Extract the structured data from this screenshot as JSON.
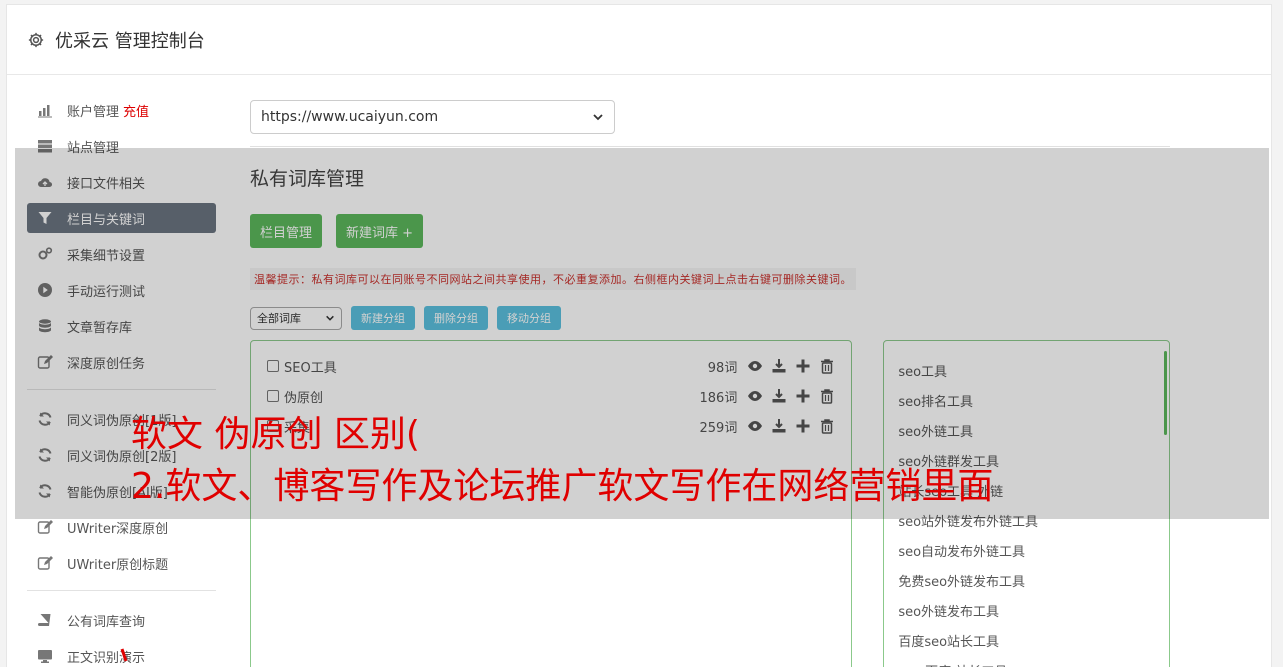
{
  "header": {
    "title": "优采云 管理控制台"
  },
  "sidebar": {
    "group1": [
      {
        "label": "账户管理",
        "badge": "充值",
        "icon": "bar-chart-icon"
      },
      {
        "label": "站点管理",
        "icon": "server-icon"
      },
      {
        "label": "接口文件相关",
        "icon": "cloud-upload-icon"
      },
      {
        "label": "栏目与关键词",
        "icon": "filter-icon",
        "active": true
      },
      {
        "label": "采集细节设置",
        "icon": "gears-icon"
      },
      {
        "label": "手动运行测试",
        "icon": "play-circle-icon"
      },
      {
        "label": "文章暂存库",
        "icon": "database-icon"
      },
      {
        "label": "深度原创任务",
        "icon": "edit-icon"
      }
    ],
    "group2": [
      {
        "label": "同义词伪原创[1版]",
        "icon": "refresh-icon"
      },
      {
        "label": "同义词伪原创[2版]",
        "icon": "refresh-icon"
      },
      {
        "label": "智能伪原创[AI版]",
        "icon": "refresh-icon"
      },
      {
        "label": "UWriter深度原创",
        "icon": "edit-icon"
      },
      {
        "label": "UWriter原创标题",
        "icon": "edit-icon"
      }
    ],
    "group3": [
      {
        "label": "公有词库查询",
        "icon": "book-icon"
      },
      {
        "label": "正文识别演示",
        "icon": "monitor-icon"
      }
    ]
  },
  "main": {
    "site_select": "https://www.ucaiyun.com",
    "section_title": "私有词库管理",
    "buttons": {
      "column_manage": "栏目管理",
      "new_library": "新建词库 +"
    },
    "tip": "温馨提示：私有词库可以在同账号不同网站之间共享使用，不必重复添加。右侧框内关键词上点击右键可删除关键词。",
    "filter_select": "全部词库",
    "group_buttons": {
      "new_group": "新建分组",
      "delete_group": "删除分组",
      "move_group": "移动分组"
    },
    "libraries": [
      {
        "name": "SEO工具",
        "count": "98词"
      },
      {
        "name": "伪原创",
        "count": "186词"
      },
      {
        "name": "采集",
        "count": "259词"
      }
    ],
    "keywords": [
      "seo工具",
      "seo排名工具",
      "seo外链工具",
      "seo外链群发工具",
      "站长seo工具 外链",
      "seo站外链发布外链工具",
      "seo自动发布外链工具",
      "免费seo外链发布工具",
      "seo外链发布工具",
      "百度seo站长工具",
      "seo 百度 站长工具"
    ]
  },
  "overlay": {
    "line1": "软文 伪原创 区别(",
    "line2": "2.软文、博客写作及论坛推广软文写作在网络营销里面"
  }
}
